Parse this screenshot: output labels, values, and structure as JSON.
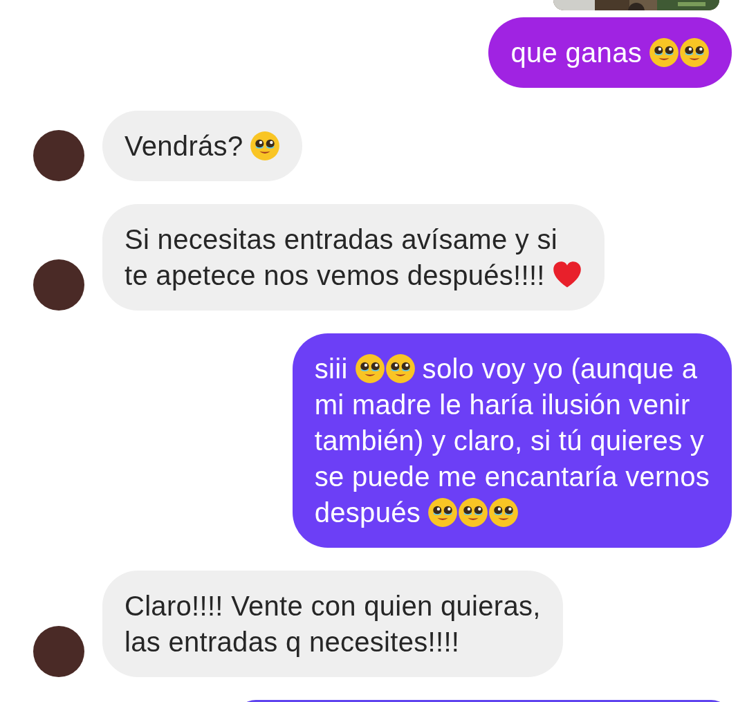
{
  "messages": [
    {
      "kind": "sent",
      "color": "#a023e2",
      "lines": [
        [
          {
            "kind": "text",
            "text": "que ganas"
          },
          {
            "kind": "emoji"
          },
          {
            "kind": "emoji"
          }
        ]
      ]
    },
    {
      "kind": "received",
      "lines": [
        [
          {
            "kind": "text",
            "text": "Vendrás?"
          },
          {
            "kind": "emoji"
          }
        ]
      ]
    },
    {
      "kind": "received",
      "lines": [
        [
          {
            "kind": "text",
            "text": "Si necesitas entradas avísame y si"
          }
        ],
        [
          {
            "kind": "text",
            "text": "te apetece nos vemos después!!!!"
          },
          {
            "kind": "heart"
          }
        ]
      ]
    },
    {
      "kind": "sent",
      "color": "#6c3ff6",
      "lines": [
        [
          {
            "kind": "text",
            "text": "siii"
          },
          {
            "kind": "emoji"
          },
          {
            "kind": "emoji"
          },
          {
            "kind": "text",
            "text": "solo voy yo (aunque a"
          }
        ],
        [
          {
            "kind": "text",
            "text": "mi madre le haría ilusión venir"
          }
        ],
        [
          {
            "kind": "text",
            "text": "también) y claro, si tú quieres y"
          }
        ],
        [
          {
            "kind": "text",
            "text": "se puede me encantaría vernos"
          }
        ],
        [
          {
            "kind": "text",
            "text": "después"
          },
          {
            "kind": "emoji"
          },
          {
            "kind": "emoji"
          },
          {
            "kind": "emoji"
          }
        ]
      ]
    },
    {
      "kind": "received",
      "lines": [
        [
          {
            "kind": "text",
            "text": "Claro!!!! Vente con quien quieras,"
          }
        ],
        [
          {
            "kind": "text",
            "text": "las entradas q necesites!!!!"
          }
        ]
      ]
    },
    {
      "kind": "sent",
      "color": "#5f44ef"
    }
  ]
}
